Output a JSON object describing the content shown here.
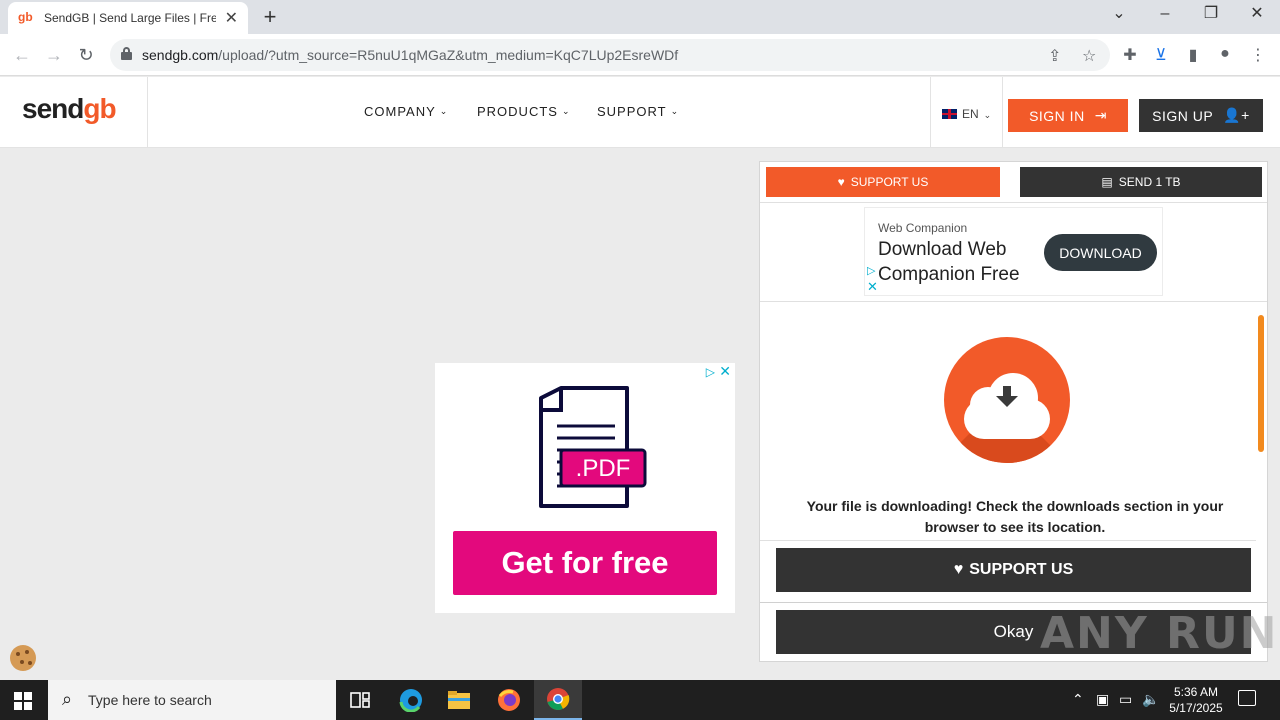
{
  "browser": {
    "tab_title": "SendGB | Send Large Files | Free f",
    "tab_favicon": "gb",
    "new_tab_label": "+",
    "url_host": "sendgb.com",
    "url_path": "/upload/?utm_source=R5nuU1qMGaZ&utm_medium=KqC7LUp2EsreWDf",
    "window_controls": [
      "⌄",
      "–",
      "❐",
      "✕"
    ]
  },
  "header": {
    "logo_main": "send",
    "logo_accent": "gb",
    "menu": [
      {
        "label": "COMPANY"
      },
      {
        "label": "PRODUCTS"
      },
      {
        "label": "SUPPORT"
      }
    ],
    "language": "EN",
    "sign_in_label": "SIGN IN",
    "sign_up_label": "SIGN UP",
    "accent_color": "#f25a29",
    "dark_color": "#333333"
  },
  "center_ad": {
    "badge_text": ".PDF",
    "cta_label": "Get for free",
    "cta_color": "#e3097d"
  },
  "panel": {
    "support_top_label": "SUPPORT US",
    "send_label": "SEND 1 TB",
    "ad": {
      "label": "Web Companion",
      "title": "Download Web Companion Free",
      "button_label": "DOWNLOAD"
    },
    "download_message": "Your file is downloading! Check the downloads section in your browser to see its location.",
    "support_main_label": "SUPPORT US",
    "okay_label": "Okay"
  },
  "watermark": "ANY RUN",
  "taskbar": {
    "search_placeholder": "Type here to search",
    "apps": [
      "task-view",
      "edge",
      "file-explorer",
      "firefox",
      "chrome"
    ],
    "time": "5:36 AM",
    "date": "5/17/2025"
  }
}
